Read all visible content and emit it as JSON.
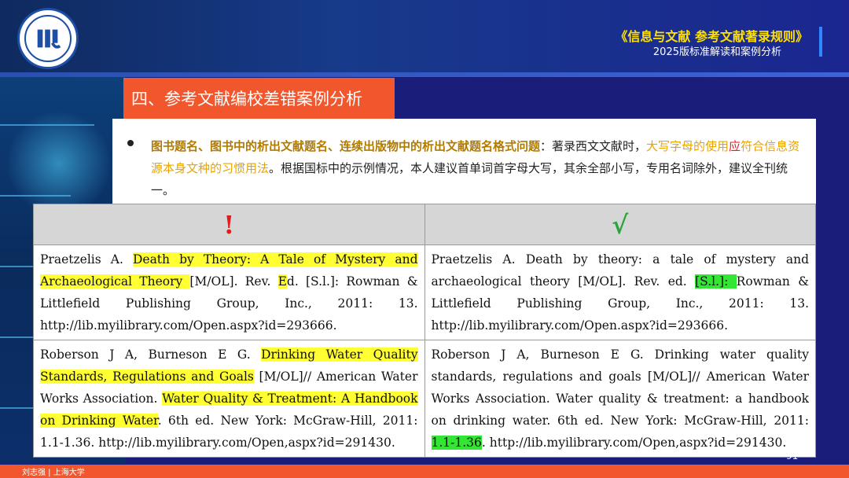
{
  "header": {
    "title": "《信息与文献  参考文献著录规则》",
    "subtitle": "2025版标准解读和案例分析",
    "logo_icon": "university-seal-icon"
  },
  "section": {
    "title": "四、参考文献编校差错案例分析"
  },
  "bullet": {
    "bold_part": "图书题名、图书中的析出文献题名、连续出版物中的析出文献题名格式问题",
    "colon": "：著录西文文献时，",
    "orange_part1": "大写字母的使用",
    "red_part": "应",
    "orange_part2": "符合信息资源本身文种的习惯用法",
    "rest": "。根据国标中的示例情况，本人建议首单词首字母大写，其余全部小写，专用名词除外，建议全刊统一。"
  },
  "table": {
    "header_wrong": "!",
    "header_right": "√",
    "rows": [
      {
        "wrong": {
          "a": "Praetzelis A. ",
          "b": "Death by Theory: A Tale of Mystery and Archaeological Theory ",
          "c": "[M/OL]. Rev. ",
          "d": "E",
          "e": "d. [S.l.]: Rowman & Littlefield Publishing Group, Inc., 2011: 13. http://lib.myilibrary.com/Open.aspx?id=293666."
        },
        "right": {
          "a": "Praetzelis A. Death by theory: a tale of mystery and archaeological theory [M/OL]. Rev. ed. ",
          "b": "[S.l.]: ",
          "c": "Rowman & Littlefield Publishing Group, Inc., 2011: 13. http://lib.myilibrary.com/Open.aspx?id=293666."
        }
      },
      {
        "wrong": {
          "a": "Roberson J A, Burneson E G. ",
          "b": "Drinking Water Quality Standards, Regulations and Goals",
          "c": " [M/OL]// American Water Works Association. ",
          "d": "Water Quality & Treatment: A Handbook on Drinking Water",
          "e": ". 6th ed. New York: McGraw-Hill, 2011: 1.1-1.36. http://lib.myilibrary.com/Open,aspx?id=291430."
        },
        "right": {
          "a": "Roberson J A, Burneson E G. Drinking water quality standards, regulations and goals [M/OL]// American Water Works Association. Water quality & treatment: a handbook on drinking water. 6th ed. New York: McGraw-Hill, 2011: ",
          "b": "1.1-1.36",
          "c": ". http://lib.myilibrary.com/Open,aspx?id=291430."
        }
      }
    ]
  },
  "page_number": "91",
  "footer": {
    "text": "刘志强 | 上海大学"
  },
  "colors": {
    "accent": "#f2562d",
    "background": "#1b1d7a",
    "highlight_yellow": "#ffff33",
    "highlight_green": "#33e633"
  }
}
